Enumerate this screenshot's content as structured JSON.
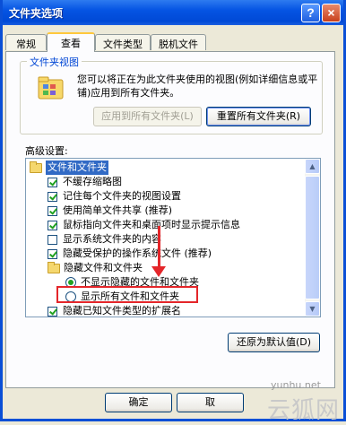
{
  "window": {
    "title": "文件夹选项",
    "help_label": "?",
    "close_label": "×"
  },
  "tabs": [
    {
      "label": "常规",
      "active": false
    },
    {
      "label": "查看",
      "active": true
    },
    {
      "label": "文件类型",
      "active": false
    },
    {
      "label": "脱机文件",
      "active": false
    }
  ],
  "folder_views": {
    "group_label": "文件夹视图",
    "description": "您可以将正在为此文件夹使用的视图(例如详细信息或平铺)应用到所有文件夹。",
    "apply_all_label": "应用到所有文件夹(L)",
    "reset_all_label": "重置所有文件夹(R)"
  },
  "advanced": {
    "label": "高级设置:",
    "items": [
      {
        "type": "folder",
        "label": "文件和文件夹",
        "selected": true
      },
      {
        "type": "checkbox",
        "label": "不缓存缩略图",
        "checked": true
      },
      {
        "type": "checkbox",
        "label": "记住每个文件夹的视图设置",
        "checked": true
      },
      {
        "type": "checkbox",
        "label": "使用简单文件共享 (推荐)",
        "checked": true
      },
      {
        "type": "checkbox",
        "label": "鼠标指向文件夹和桌面项时显示提示信息",
        "checked": true
      },
      {
        "type": "checkbox",
        "label": "显示系统文件夹的内容",
        "checked": false
      },
      {
        "type": "checkbox",
        "label": "隐藏受保护的操作系统文件 (推荐)",
        "checked": true
      },
      {
        "type": "folder",
        "label": "隐藏文件和文件夹",
        "selected": false
      },
      {
        "type": "radio",
        "label": "不显示隐藏的文件和文件夹",
        "checked": true
      },
      {
        "type": "radio",
        "label": "显示所有文件和文件夹",
        "checked": false
      },
      {
        "type": "checkbox",
        "label": "隐藏已知文件类型的扩展名",
        "checked": true
      }
    ],
    "restore_defaults_label": "还原为默认值(D)"
  },
  "footer": {
    "ok_label": "确定",
    "cancel_label": "取"
  },
  "watermark": {
    "url": "yunhu.net",
    "brand": "云狐网"
  },
  "colors": {
    "highlight": "#e4262a",
    "title_bar": "#0554e3",
    "selection": "#316ac5"
  }
}
